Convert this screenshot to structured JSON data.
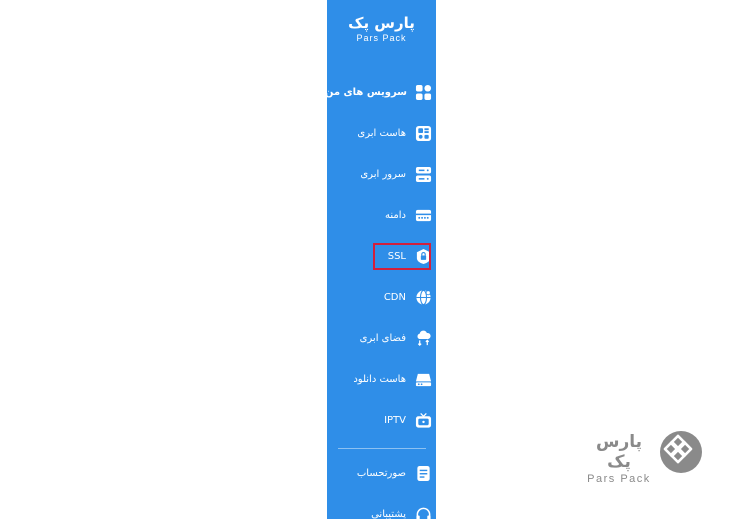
{
  "brand": {
    "name_fa": "پارس پک",
    "name_en": "Pars Pack"
  },
  "menu": {
    "items": [
      {
        "label": "سرویس های من",
        "icon": "grid-icon",
        "active": true
      },
      {
        "label": "هاست ابری",
        "icon": "cloud-host-icon"
      },
      {
        "label": "سرور ابری",
        "icon": "server-icon"
      },
      {
        "label": "دامنه",
        "icon": "domain-icon"
      },
      {
        "label": "SSL",
        "icon": "lock-icon",
        "highlighted": true
      },
      {
        "label": "CDN",
        "icon": "globe-icon"
      },
      {
        "label": "فضای ابری",
        "icon": "cloud-storage-icon"
      },
      {
        "label": "هاست دانلود",
        "icon": "download-host-icon"
      },
      {
        "label": "IPTV",
        "icon": "tv-icon"
      }
    ],
    "footer_items": [
      {
        "label": "صورتحساب",
        "icon": "invoice-icon"
      },
      {
        "label": "پشتیبانی",
        "icon": "headset-icon"
      }
    ]
  },
  "watermark": {
    "name_fa": "پارس پک",
    "name_en": "Pars Pack"
  },
  "colors": {
    "sidebar": "#2f8ee8",
    "highlight": "#d21f3c",
    "watermark": "#8a8a8a"
  }
}
